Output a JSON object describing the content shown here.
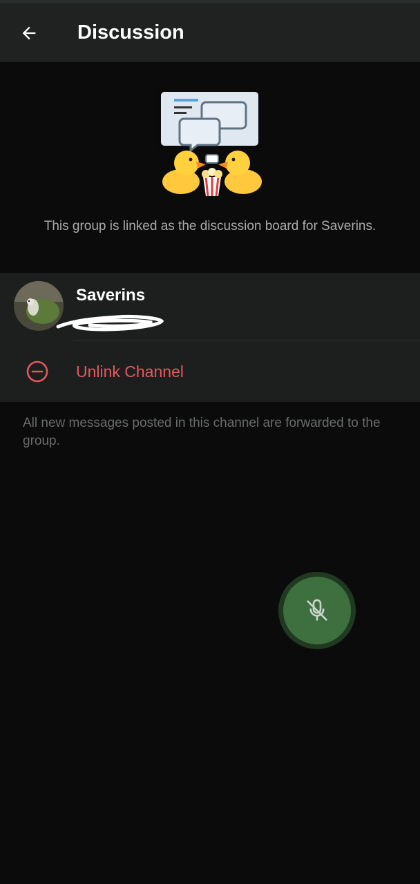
{
  "header": {
    "title": "Discussion",
    "back_icon": "arrow-left-icon"
  },
  "intro": {
    "sticker": "ducks-discussion-sticker",
    "text": "This group is linked as the discussion board for Saverins."
  },
  "channel": {
    "name": "Saverins",
    "avatar_icon": "hedgehog-avatar",
    "handle_obscured": true
  },
  "actions": {
    "unlink_label": "Unlink Channel",
    "unlink_icon": "minus-circle-icon"
  },
  "footer": {
    "note": "All new messages posted in this channel are forwarded to the group."
  },
  "fab": {
    "icon": "mic-off-icon"
  },
  "colors": {
    "background": "#0b0b0b",
    "app_bar": "#202222",
    "card": "#1d1f1f",
    "destructive": "#e5585d",
    "secondary_text": "#a9abab",
    "hint_text": "#696c6c",
    "fab": "#3e6f3e"
  }
}
